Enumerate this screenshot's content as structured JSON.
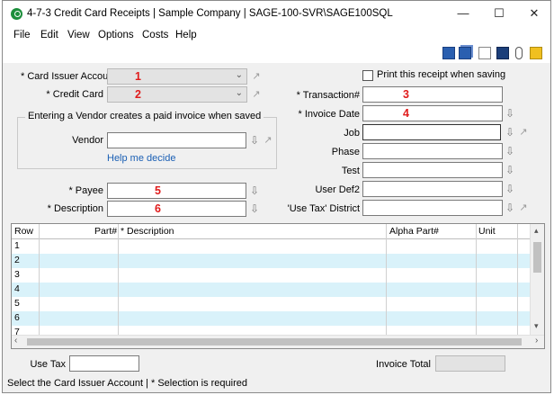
{
  "window": {
    "title": "4-7-3 Credit Card Receipts | Sample Company | SAGE-100-SVR\\SAGE100SQL",
    "minimize": "—",
    "maximize": "☐",
    "close": "✕"
  },
  "menu": [
    "File",
    "Edit",
    "View",
    "Options",
    "Costs",
    "Help"
  ],
  "form": {
    "card_issuer_label": "* Card Issuer Account",
    "card_issuer_marker": "1",
    "credit_card_label": "* Credit Card",
    "credit_card_marker": "2",
    "vendor_group_title": "Entering a Vendor creates a paid invoice when saved",
    "vendor_label": "Vendor",
    "help_link": "Help me decide",
    "payee_label": "* Payee",
    "payee_marker": "5",
    "description_label": "* Description",
    "description_marker": "6",
    "print_receipt_label": "Print this receipt when saving",
    "transaction_label": "* Transaction#",
    "transaction_marker": "3",
    "invoice_date_label": "* Invoice Date",
    "invoice_date_marker": "4",
    "job_label": "Job",
    "phase_label": "Phase",
    "test_label": "Test",
    "user_def2_label": "User Def2",
    "use_tax_district_label": "'Use Tax' District"
  },
  "grid": {
    "columns": [
      "Row",
      "Part#",
      "* Description",
      "Alpha Part#",
      "Unit"
    ],
    "rows": [
      "1",
      "2",
      "3",
      "4",
      "5",
      "6",
      "7"
    ]
  },
  "footer": {
    "use_tax_label": "Use Tax",
    "invoice_total_label": "Invoice Total"
  },
  "status": {
    "text": "Select the Card Issuer Account  |  * Selection is required"
  },
  "colors": {
    "marker": "#e01b1b",
    "row_alt": "#d9f2fa",
    "link": "#1a5fb4"
  }
}
